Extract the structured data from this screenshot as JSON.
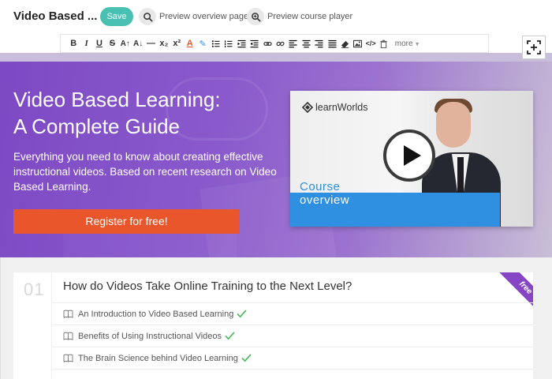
{
  "topbar": {
    "title": "Video Based ...",
    "save_label": "Save",
    "preview_overview": "Preview overview page",
    "preview_player": "Preview course player"
  },
  "toolbar": {
    "buttons": [
      "B",
      "I",
      "U",
      "S",
      "A↑",
      "A↓",
      "—",
      "x₂",
      "x²",
      "A",
      "✎",
      "•≡",
      "1≡",
      "⇥",
      "⇤",
      "link",
      "unlink",
      "≡L",
      "≡C",
      "≡R",
      "≡J",
      "eraser",
      "image",
      "</>",
      "trash"
    ],
    "more_label": "more"
  },
  "hero": {
    "title_line1": "Video Based Learning:",
    "title_line2": "A Complete Guide",
    "description": "Everything you need to know about creating effective instructional videos. Based on recent research on Video Based Learning.",
    "register_label": "Register for free!",
    "video": {
      "brand": "learnWorlds",
      "caption_line1": "Course",
      "caption_line2": "overview"
    }
  },
  "curriculum": {
    "section_number": "01",
    "section_title": "How do Videos Take Online Training to the Next Level?",
    "badge": "free",
    "lessons": [
      "An Introduction to Video Based Learning",
      "Benefits of Using Instructional Videos",
      "The Brain Science behind Video Learning"
    ]
  },
  "colors": {
    "save": "#49c1b2",
    "hero_purple": "#7d49c4",
    "register": "#e9562b",
    "video_blue": "#2f8fe0",
    "check_green": "#4cb85c",
    "badge_purple": "#8645c4"
  }
}
